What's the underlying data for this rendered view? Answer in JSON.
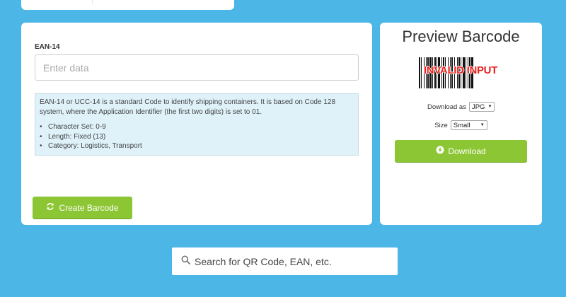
{
  "generator": {
    "field_label": "EAN-14",
    "input_value": "",
    "input_placeholder": "Enter data",
    "info": {
      "description": "EAN-14 or UCC-14 is a standard Code to identify shipping containers. It is based on Code 128 system, where the Application Identifier (the first two digits) is set to 01.",
      "details": [
        "Character Set: 0-9",
        "Length: Fixed (13)",
        "Category: Logistics, Transport"
      ]
    },
    "create_button": {
      "label": "Create Barcode",
      "icon": "refresh-icon"
    }
  },
  "preview": {
    "title": "Preview Barcode",
    "barcode_error_text": "INVALID INPUT",
    "download_as_label": "Download as",
    "format_selected": "JPG",
    "size_label": "Size",
    "size_selected": "Small",
    "download_button": {
      "label": "Download",
      "icon": "download-circle-icon"
    }
  },
  "search": {
    "placeholder": "Search for QR Code, EAN, etc.",
    "icon": "search-icon"
  },
  "colors": {
    "page_background": "#4cb6e6",
    "button_green": "#8dc634",
    "info_box_background": "#dff2fa",
    "error_red": "#e8201b"
  }
}
